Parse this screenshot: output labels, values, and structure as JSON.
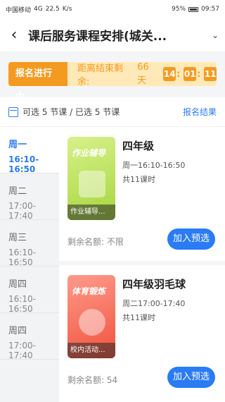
{
  "status_bar": {
    "carrier": "中国移动",
    "signal": "4G",
    "speed_value": "22.5",
    "speed_unit": "K/s",
    "battery": "95%",
    "time": "09:57"
  },
  "header": {
    "title": "课后服务课程安排(城关..."
  },
  "banner": {
    "badge": "报名进行中",
    "countdown_label": "距离结束剩余:",
    "days": "66 天",
    "hours": "14",
    "minutes": "01",
    "seconds": "11"
  },
  "info": {
    "text": "可选 5 节课 / 已选 5 节课",
    "result_link": "报名结果"
  },
  "days": [
    {
      "day": "周一",
      "time": "16:10-16:50",
      "active": true
    },
    {
      "day": "周二",
      "time": "17:00-17:40",
      "active": false
    },
    {
      "day": "周三",
      "time": "16:10-16:50",
      "active": false
    },
    {
      "day": "周四",
      "time": "16:10-16:50",
      "active": false
    },
    {
      "day": "周四",
      "time": "17:00-17:40",
      "active": false
    }
  ],
  "courses": [
    {
      "name": "四年级",
      "time": "周一16:10-16:50",
      "count": "共11课时",
      "thumb_title": "作业辅导",
      "thumb_caption": "作业辅导...",
      "remain": "剩余名额:  不限",
      "button": "加入预选"
    },
    {
      "name": "四年级羽毛球",
      "time": "周二17:00-17:40",
      "count": "共11课时",
      "thumb_title": "体育锻炼",
      "thumb_caption": "校内活动...",
      "remain": "剩余名额:  54",
      "button": "加入预选"
    }
  ],
  "colors": {
    "accent": "#2a7bf5",
    "orange": "#f59a21"
  }
}
